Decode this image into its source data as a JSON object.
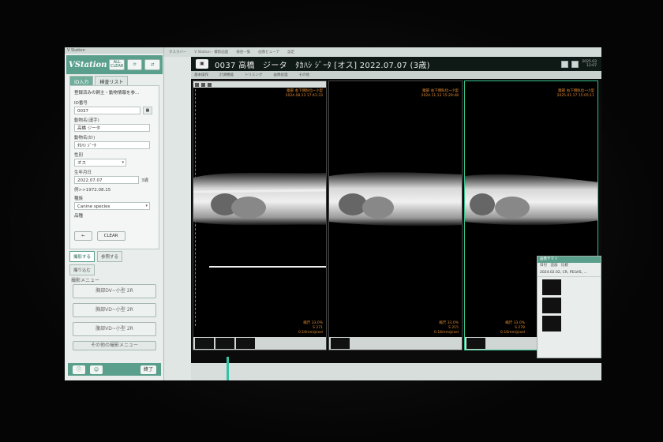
{
  "left_panel": {
    "window_title": "V Station",
    "logo": "VStation",
    "all_clear": "ALL CLEAR",
    "tabs": [
      "ID入力",
      "検査リスト"
    ],
    "note": "登録済みの飼主・動物情報を参...",
    "fields": {
      "id_label": "ID番号",
      "id_value": "0037",
      "name_kanji_label": "動物名(漢字)",
      "name_kanji_value": "高橋 ジータ",
      "name_kana_label": "動物名(ｶﾅ)",
      "name_kana_value": "ﾀｶﾊｼ ｼﾞｰﾀ",
      "sex_label": "性別",
      "sex_value": "オス",
      "dob_label": "生年月日",
      "dob_value": "2022.07.07",
      "age_value": "3歳",
      "example": "例>>1972.08.15",
      "species_label": "種族",
      "species_value": "Canine species",
      "breed_label": "品種"
    },
    "enter_label": "←",
    "clear_label": "CLEAR",
    "tabs2": [
      "撮影する",
      "参照する",
      "撮り込む"
    ],
    "menu_title": "撮影メニュー",
    "menu_items": [
      "胸部DV~小型 2R",
      "胸部VD~小型 2R",
      "腹部VD~小型 2R"
    ],
    "other_menu": "その他の撮影メニュー",
    "footer_end": "終了"
  },
  "top_strip": [
    "タスクバー",
    "V Station - 撮影画面",
    "検査一覧",
    "画像ビューア",
    "設定"
  ],
  "viewer": {
    "title": "0037 高橋　ジータ　ﾀｶﾊｼ ｼﾞｰﾀ [オス]  2022.07.07 (3歳)",
    "time_line1": "2025.03",
    "time_line2": "12:07",
    "toolbar": [
      "基本操作",
      "計測機能",
      "トリミング",
      "画像処理",
      "その他"
    ],
    "panes": [
      {
        "info1": "腹部 右下側臥位~小型",
        "info2": "2024.08.13 17:41:33",
        "footer1": "縮尺 33.0%",
        "footer2": "S 271",
        "footer3": "0.16mm/pixel"
      },
      {
        "info1": "腹部 右下側臥位~小型",
        "info2": "2024.11.13 15:29:48",
        "footer1": "縮尺 33.0%",
        "footer2": "S 215",
        "footer3": "0.16mm/pixel"
      },
      {
        "info1": "腹部 右下側臥位~小型",
        "info2": "2025.01.17 15:05:11",
        "footer1": "縮尺 33.0%",
        "footer2": "S 278",
        "footer3": "0.16mm/pixel"
      }
    ]
  },
  "thumb_window": {
    "title": "画像サマリ",
    "tools": "日付　追加　比較",
    "item": "2024.02.02, CR, PELVIS, ..."
  }
}
